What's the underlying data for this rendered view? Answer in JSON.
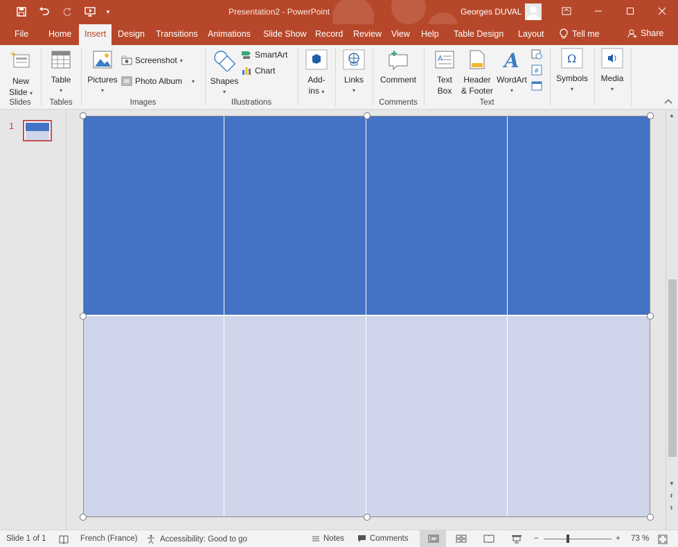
{
  "app": {
    "title": "Presentation2  -  PowerPoint",
    "user": "Georges DUVAL",
    "colors": {
      "brand": "#b7472a",
      "table_header": "#4472c4",
      "table_body": "#cfd5ea"
    }
  },
  "qat": {
    "icons": [
      "save-icon",
      "undo-icon",
      "redo-icon",
      "present-from-beginning-icon",
      "customize-qat-icon"
    ]
  },
  "window_controls": [
    "ribbon-display-options-icon",
    "minimize-icon",
    "maximize-icon",
    "close-icon"
  ],
  "tabs": [
    {
      "label": "File"
    },
    {
      "label": "Home"
    },
    {
      "label": "Insert",
      "active": true
    },
    {
      "label": "Design"
    },
    {
      "label": "Transitions"
    },
    {
      "label": "Animations"
    },
    {
      "label": "Slide Show"
    },
    {
      "label": "Record"
    },
    {
      "label": "Review"
    },
    {
      "label": "View"
    },
    {
      "label": "Help"
    },
    {
      "label": "Table Design"
    },
    {
      "label": "Layout"
    }
  ],
  "tell_me": "Tell me",
  "share": "Share",
  "ribbon": {
    "slides": {
      "new_slide_1": "New",
      "new_slide_2": "Slide",
      "group": "Slides"
    },
    "tables": {
      "table": "Table",
      "group": "Tables"
    },
    "images": {
      "pictures": "Pictures",
      "screenshot": "Screenshot",
      "photo_album": "Photo Album",
      "group": "Images"
    },
    "illustrations": {
      "shapes": "Shapes",
      "smartart": "SmartArt",
      "chart": "Chart",
      "group": "Illustrations"
    },
    "addins": {
      "label_1": "Add-",
      "label_2": "ins"
    },
    "links": {
      "label": "Links"
    },
    "comments": {
      "comment": "Comment",
      "group": "Comments"
    },
    "text": {
      "text_box_1": "Text",
      "text_box_2": "Box",
      "header_footer_1": "Header",
      "header_footer_2": "& Footer",
      "wordart": "WordArt",
      "group": "Text"
    },
    "symbols": {
      "label": "Symbols"
    },
    "media": {
      "label": "Media"
    }
  },
  "thumbnails": {
    "slide_number": "1"
  },
  "table": {
    "columns": 4,
    "rows": 2
  },
  "status": {
    "slide": "Slide 1 of 1",
    "language": "French (France)",
    "accessibility": "Accessibility: Good to go",
    "notes": "Notes",
    "comments": "Comments",
    "zoom": "73 %",
    "zoom_minus": "−",
    "zoom_plus": "+"
  }
}
